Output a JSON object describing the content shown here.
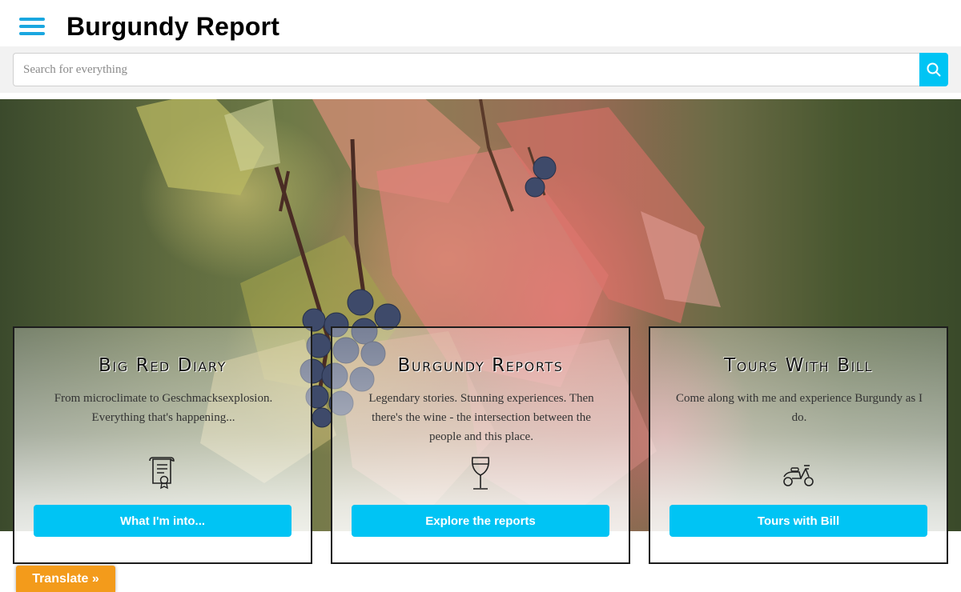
{
  "header": {
    "title": "Burgundy Report",
    "menu_icon": "hamburger-menu-icon"
  },
  "search": {
    "placeholder": "Search for everything",
    "value": "",
    "icon": "search-icon"
  },
  "hero": {
    "image": "autumn vine leaves with grape cluster"
  },
  "cards": [
    {
      "title": "Big Red Diary",
      "text": "From microclimate to Geschmacksexplosion. Everything that's happening...",
      "icon": "certificate-icon",
      "button": "What I'm into..."
    },
    {
      "title": "Burgundy Reports",
      "text": "Legendary stories. Stunning experiences. Then there's the wine - the intersection between the people and this place.",
      "icon": "wine-glass-icon",
      "button": "Explore the reports"
    },
    {
      "title": "Tours With Bill",
      "text": "Come along with me and experience Burgundy as I do.",
      "icon": "scooter-icon",
      "button": "Tours with Bill"
    }
  ],
  "translate": {
    "label": "Translate »"
  },
  "colors": {
    "accent": "#00c4f4",
    "menu": "#1aa7e0",
    "translate": "#f39b1b"
  }
}
